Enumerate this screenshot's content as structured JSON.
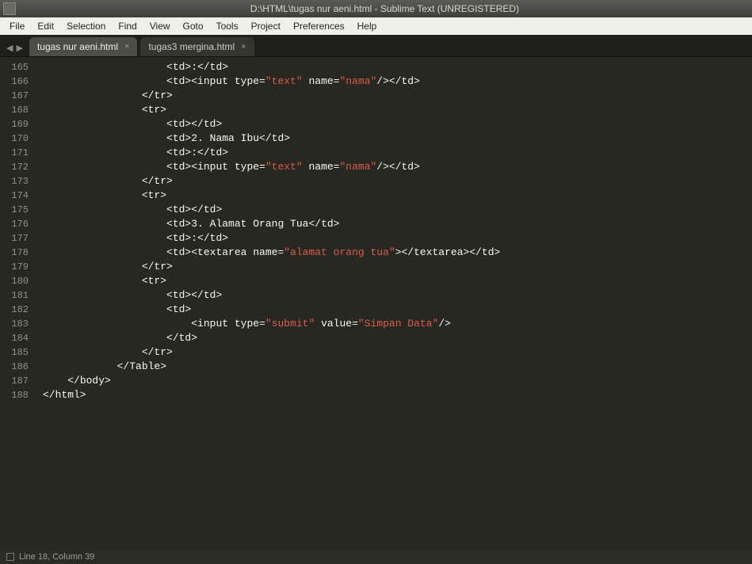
{
  "window": {
    "title": "D:\\HTML\\tugas nur aeni.html - Sublime Text (UNREGISTERED)"
  },
  "menubar": [
    "File",
    "Edit",
    "Selection",
    "Find",
    "View",
    "Goto",
    "Tools",
    "Project",
    "Preferences",
    "Help"
  ],
  "navarrows": {
    "left": "◀",
    "right": "▶"
  },
  "tabs": [
    {
      "label": "tugas nur aeni.html",
      "active": true
    },
    {
      "label": "tugas3 mergina.html",
      "active": false
    }
  ],
  "gutter_start": 165,
  "gutter_end": 188,
  "code_lines": [
    [
      [
        "p",
        "                    "
      ],
      [
        "p",
        "<td>:</td>"
      ]
    ],
    [
      [
        "p",
        "                    "
      ],
      [
        "p",
        "<td><input type="
      ],
      [
        "sr",
        "\"text\""
      ],
      [
        "p",
        " name="
      ],
      [
        "sr",
        "\"nama\""
      ],
      [
        "p",
        "/></td>"
      ]
    ],
    [
      [
        "p",
        "                "
      ],
      [
        "p",
        "</tr>"
      ]
    ],
    [
      [
        "p",
        "                "
      ],
      [
        "p",
        "<tr>"
      ]
    ],
    [
      [
        "p",
        "                    "
      ],
      [
        "p",
        "<td></td>"
      ]
    ],
    [
      [
        "p",
        "                    "
      ],
      [
        "p",
        "<td>2. Nama Ibu</td>"
      ]
    ],
    [
      [
        "p",
        "                    "
      ],
      [
        "p",
        "<td>:</td>"
      ]
    ],
    [
      [
        "p",
        "                    "
      ],
      [
        "p",
        "<td><input type="
      ],
      [
        "sr",
        "\"text\""
      ],
      [
        "p",
        " name="
      ],
      [
        "sr",
        "\"nama\""
      ],
      [
        "p",
        "/></td>"
      ]
    ],
    [
      [
        "p",
        "                "
      ],
      [
        "p",
        "</tr>"
      ]
    ],
    [
      [
        "p",
        "                "
      ],
      [
        "p",
        "<tr>"
      ]
    ],
    [
      [
        "p",
        "                    "
      ],
      [
        "p",
        "<td></td>"
      ]
    ],
    [
      [
        "p",
        "                    "
      ],
      [
        "p",
        "<td>3. Alamat Orang Tua</td>"
      ]
    ],
    [
      [
        "p",
        "                    "
      ],
      [
        "p",
        "<td>:</td>"
      ]
    ],
    [
      [
        "p",
        "                    "
      ],
      [
        "p",
        "<td><textarea name="
      ],
      [
        "sr",
        "\"alamat orang tua\""
      ],
      [
        "p",
        "></textarea></td>"
      ]
    ],
    [
      [
        "p",
        "                "
      ],
      [
        "p",
        "</tr>"
      ]
    ],
    [
      [
        "p",
        "                "
      ],
      [
        "p",
        "<tr>"
      ]
    ],
    [
      [
        "p",
        "                    "
      ],
      [
        "p",
        "<td></td>"
      ]
    ],
    [
      [
        "p",
        "                    "
      ],
      [
        "p",
        "<td>"
      ]
    ],
    [
      [
        "p",
        "                        "
      ],
      [
        "p",
        "<input type="
      ],
      [
        "sr",
        "\"submit\""
      ],
      [
        "p",
        " value="
      ],
      [
        "sr",
        "\"Simpan Data\""
      ],
      [
        "p",
        "/>"
      ]
    ],
    [
      [
        "p",
        "                    "
      ],
      [
        "p",
        "</td>"
      ]
    ],
    [
      [
        "p",
        "                "
      ],
      [
        "p",
        "</tr>"
      ]
    ],
    [
      [
        "p",
        "            "
      ],
      [
        "p",
        "</Table>"
      ]
    ],
    [
      [
        "p",
        "    "
      ],
      [
        "p",
        "</body>"
      ]
    ],
    [
      [
        "p",
        ""
      ],
      [
        "p",
        "</html>"
      ]
    ]
  ],
  "statusbar": {
    "position": "Line 18, Column 39"
  }
}
